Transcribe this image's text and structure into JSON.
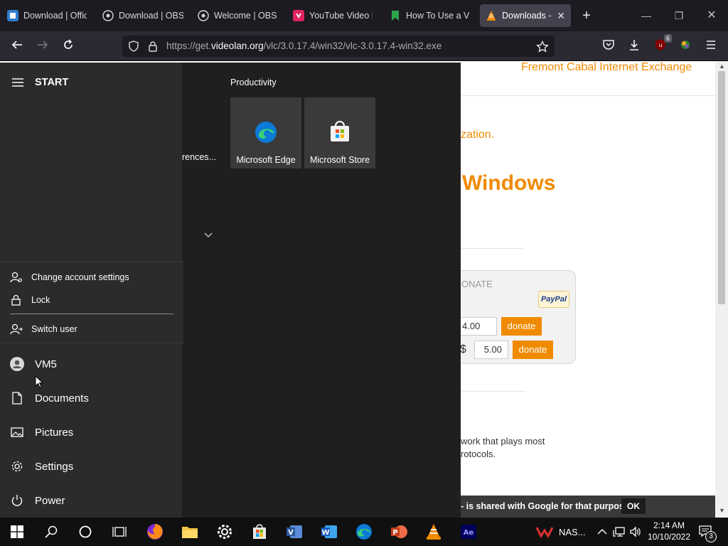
{
  "browser": {
    "tabs": [
      {
        "title": "Download | Offic",
        "icon": "office-icon"
      },
      {
        "title": "Download | OBS",
        "icon": "obs-icon"
      },
      {
        "title": "Welcome | OBS",
        "icon": "obs-icon"
      },
      {
        "title": "YouTube Video D",
        "icon": "youtube-downloader-icon"
      },
      {
        "title": "How To Use a Vid",
        "icon": "bookmark-icon"
      },
      {
        "title": "Downloads - V",
        "icon": "vlc-icon",
        "active": true
      }
    ],
    "url_prefix": "https://get.",
    "url_domain": "videolan.org",
    "url_path": "/vlc/3.0.17.4/win32/vlc-3.0.17.4-win32.exe",
    "extension_badge": "6"
  },
  "webpage": {
    "mirror": "Fremont Cabal Internet Exchange",
    "org_fragment": "zation.",
    "heading_fragment": "Windows",
    "donate_label": "ONATE",
    "paypal": "PayPal",
    "amount1": "4.00",
    "donate_button1": "donate",
    "currency": "$",
    "amount2": "5.00",
    "donate_button2": "donate",
    "desc_line1": "work that plays most",
    "desc_line2": "rotocols.",
    "cookie_text": "- is shared with Google for that purpose.",
    "cookie_ok": "OK"
  },
  "start_menu": {
    "title": "START",
    "group_title": "Productivity",
    "partial_tile_label": "rences...",
    "tiles": [
      {
        "label": "Microsoft Edge"
      },
      {
        "label": "Microsoft Store"
      }
    ],
    "account_menu": {
      "change_settings": "Change account settings",
      "lock": "Lock",
      "switch_user": "Switch user"
    },
    "rail": {
      "user": "VM5",
      "documents": "Documents",
      "pictures": "Pictures",
      "settings": "Settings",
      "power": "Power"
    }
  },
  "taskbar": {
    "tray_app": "NAS...",
    "time": "2:14 AM",
    "date": "10/10/2022",
    "notification_count": "3"
  }
}
